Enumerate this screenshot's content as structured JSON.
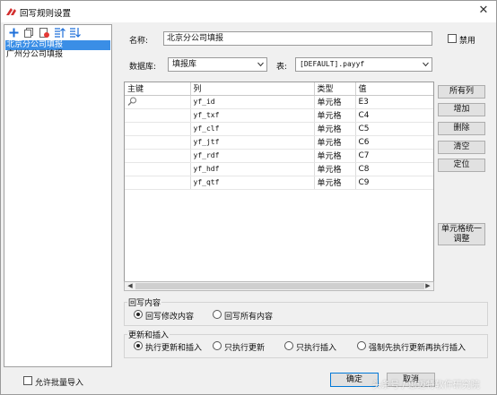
{
  "window": {
    "title": "回写规则设置",
    "close_glyph": "✕"
  },
  "toolbar": {
    "icons": [
      "plus-icon",
      "copy-icon",
      "delete-icon",
      "move-up-icon",
      "move-down-icon"
    ]
  },
  "rules": [
    {
      "label": "北京分公司填报",
      "selected": true
    },
    {
      "label": "广州分公司填报",
      "selected": false
    }
  ],
  "form": {
    "name_label": "名称:",
    "name_value": "北京分公司填报",
    "disable_label": "禁用",
    "db_label": "数据库:",
    "db_value": "填报库",
    "table_label": "表:",
    "table_value": "[DEFAULT].payyf"
  },
  "grid": {
    "headers": [
      "主键",
      "列",
      "类型",
      "值"
    ],
    "rows": [
      {
        "key": "",
        "column": "yf_id",
        "type": "单元格",
        "value": "E3"
      },
      {
        "key": "",
        "column": "yf_txf",
        "type": "单元格",
        "value": "C4"
      },
      {
        "key": "",
        "column": "yf_clf",
        "type": "单元格",
        "value": "C5"
      },
      {
        "key": "",
        "column": "yf_jtf",
        "type": "单元格",
        "value": "C6"
      },
      {
        "key": "",
        "column": "yf_rdf",
        "type": "单元格",
        "value": "C7"
      },
      {
        "key": "",
        "column": "yf_hdf",
        "type": "单元格",
        "value": "C8"
      },
      {
        "key": "",
        "column": "yf_qtf",
        "type": "单元格",
        "value": "C9"
      }
    ]
  },
  "side_buttons": {
    "all_columns": "所有列",
    "add": "增加",
    "delete": "删除",
    "clear": "清空",
    "locate": "定位",
    "unify_line1": "单元格统一",
    "unify_line2": "调整"
  },
  "writeback": {
    "title": "回写内容",
    "option1": "回写修改内容",
    "option2": "回写所有内容",
    "selected": 1
  },
  "update_insert": {
    "title": "更新和插入",
    "option1": "执行更新和插入",
    "option2": "只执行更新",
    "option3": "只执行插入",
    "option4": "强制先执行更新再执行插入",
    "selected": 1
  },
  "bottom": {
    "batch_import": "允许批量导入",
    "ok": "确定",
    "cancel": "取消",
    "watermark": "头条号 / 思迈特软件研究院"
  },
  "colors": {
    "selection": "#3a8ee6",
    "window_bg": "#f0f0f0"
  }
}
